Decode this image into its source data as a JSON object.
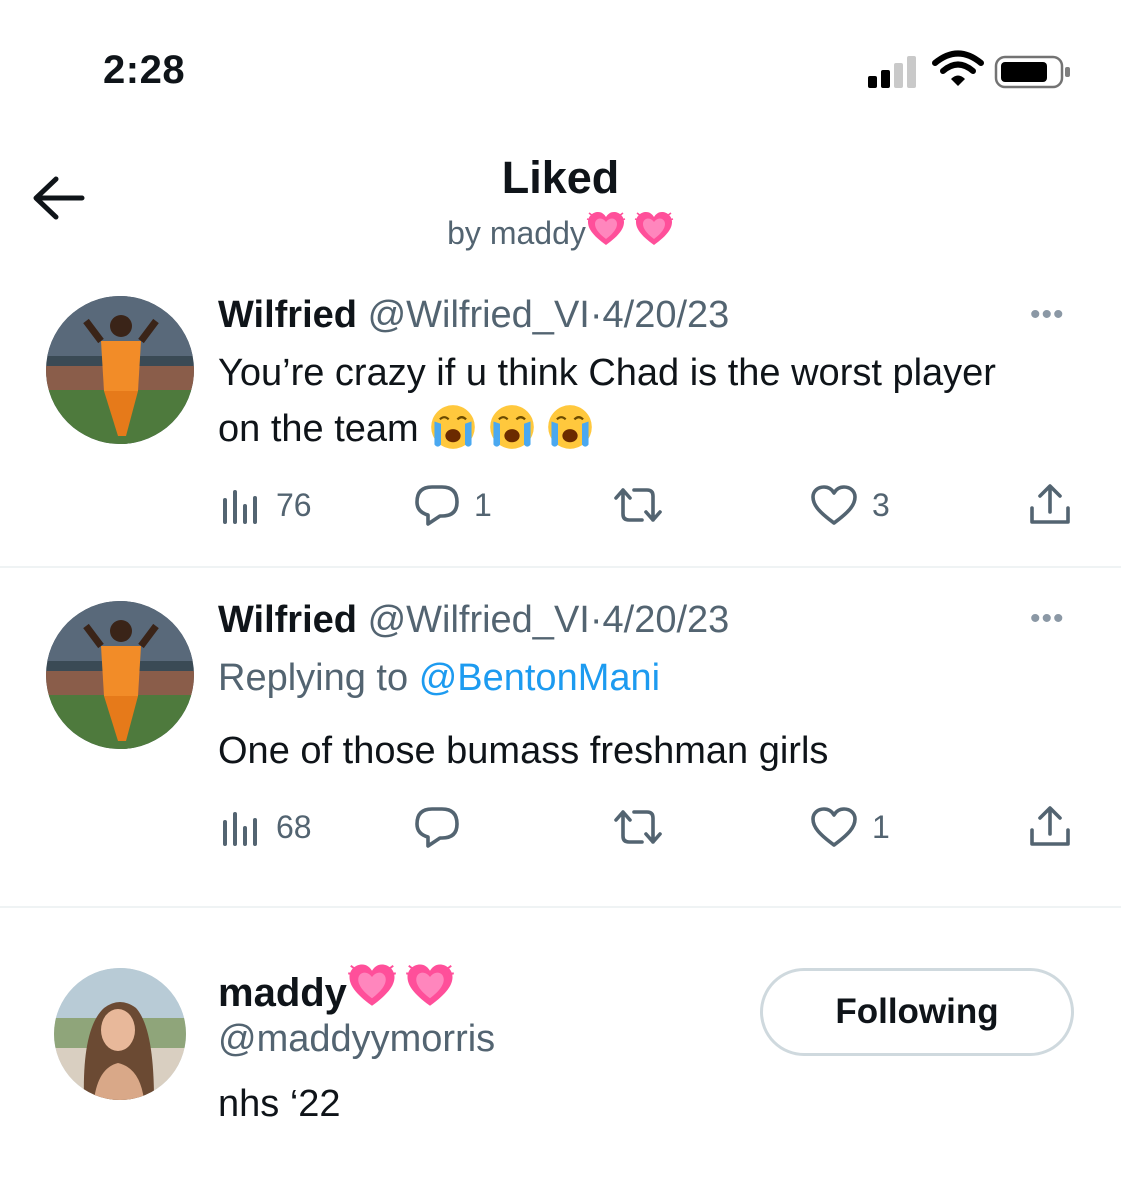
{
  "status_bar": {
    "time": "2:28"
  },
  "header": {
    "title": "Liked",
    "subtitle": "by maddy"
  },
  "tweets": [
    {
      "name": "Wilfried",
      "handle": "@Wilfried_VI",
      "separator": "·",
      "date": "4/20/23",
      "more": "•••",
      "text": "You’re crazy if u think Chad is the worst player on the team",
      "views": "76",
      "replies": "1",
      "retweets": "",
      "likes": "3"
    },
    {
      "name": "Wilfried",
      "handle": "@Wilfried_VI",
      "separator": "·",
      "date": "4/20/23",
      "more": "•••",
      "replying_label": "Replying to",
      "replying_handle": "@BentonMani",
      "text": "One of those bumass freshman girls",
      "views": "68",
      "replies": "",
      "retweets": "",
      "likes": "1"
    }
  ],
  "user_card": {
    "name": "maddy",
    "handle": "@maddyymorris",
    "bio": "nhs ‘22",
    "follow_label": "Following"
  },
  "icons": {
    "back": "arrow-left-icon",
    "views": "views-icon",
    "reply": "reply-icon",
    "retweet": "retweet-icon",
    "like": "like-icon",
    "share": "share-icon",
    "emoji_heart": "sparkling-heart-icon",
    "emoji_cry": "loudly-crying-face-icon"
  },
  "colors": {
    "text": "#0f1419",
    "secondary": "#536471",
    "link": "#1d9bf0",
    "divider": "#eff3f4",
    "heart": "#ff4f9a",
    "emoji_face": "#ffc83d",
    "emoji_tear": "#4aa8f0"
  }
}
